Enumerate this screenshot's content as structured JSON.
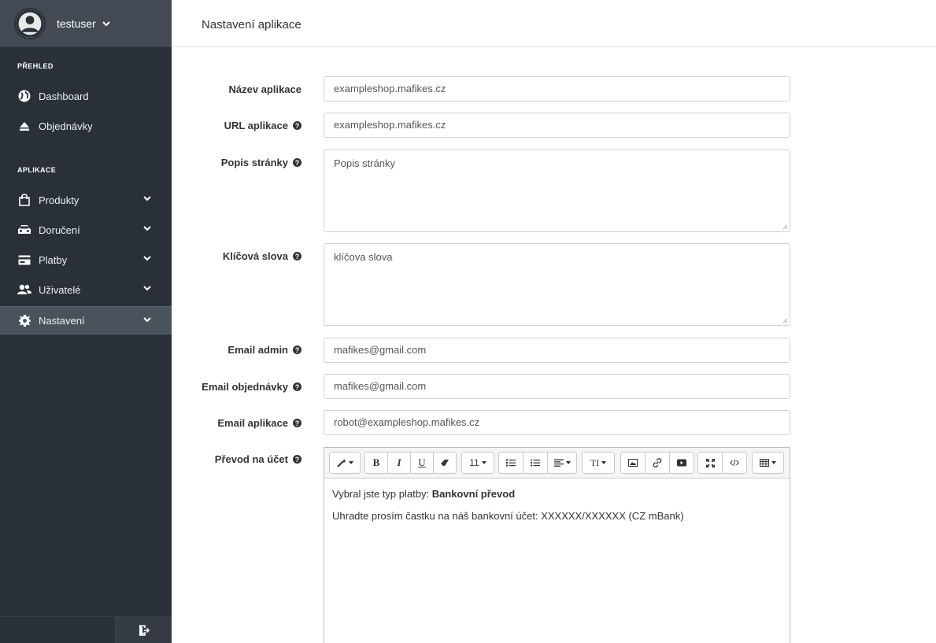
{
  "user": {
    "name": "testuser"
  },
  "sidebar": {
    "sections": [
      {
        "title": "PŘEHLED"
      },
      {
        "title": "APLIKACE"
      }
    ],
    "items": [
      {
        "label": "Dashboard",
        "icon": "globe-icon"
      },
      {
        "label": "Objednávky",
        "icon": "eject-icon"
      },
      {
        "label": "Produkty",
        "icon": "shopping-bag-icon"
      },
      {
        "label": "Doručení",
        "icon": "car-icon"
      },
      {
        "label": "Platby",
        "icon": "credit-card-icon"
      },
      {
        "label": "Uživatelé",
        "icon": "users-icon"
      },
      {
        "label": "Nastavení",
        "icon": "gear-icon"
      }
    ]
  },
  "header": {
    "title": "Nastavení aplikace"
  },
  "form": {
    "app_name": {
      "label": "Název aplikace",
      "value": "exampleshop.mafikes.cz"
    },
    "app_url": {
      "label": "URL aplikace",
      "value": "exampleshop.mafikes.cz"
    },
    "description": {
      "label": "Popis stránky",
      "value": "Popis stránky"
    },
    "keywords": {
      "label": "Klíčová slova",
      "value": "klíčova slova"
    },
    "email_admin": {
      "label": "Email admin",
      "value": "mafikes@gmail.com"
    },
    "email_orders": {
      "label": "Email objednávky",
      "value": "mafikes@gmail.com"
    },
    "email_app": {
      "label": "Email aplikace",
      "value": "robot@exampleshop.mafikes.cz"
    },
    "transfer": {
      "label": "Převod na účet",
      "line1_prefix": "Vybral jste typ platby: ",
      "line1_bold": "Bankovní převod",
      "line2": "Uhradte prosím častku na náš bankovní účet: XXXXXX/XXXXXX (CZ mBank)"
    }
  },
  "editor_toolbar": {
    "font_size": "11",
    "bold": "B",
    "italic": "I",
    "underline": "U",
    "font_family": "TI"
  }
}
